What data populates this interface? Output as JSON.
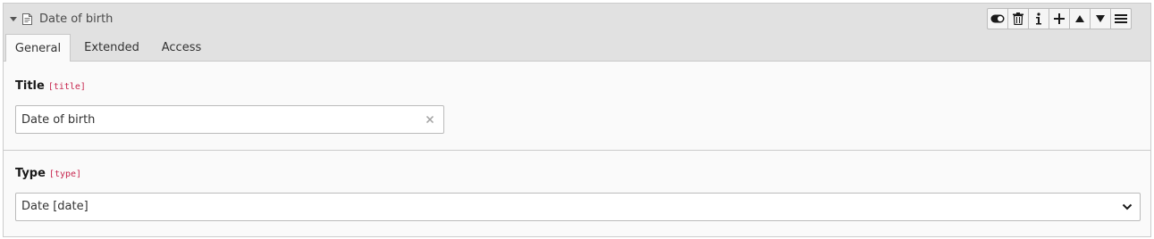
{
  "header": {
    "title": "Date of birth",
    "toolbar": [
      {
        "name": "toggle-visibility-button",
        "icon": "toggle-icon"
      },
      {
        "name": "delete-button",
        "icon": "trash-icon"
      },
      {
        "name": "info-button",
        "icon": "info-icon"
      },
      {
        "name": "add-button",
        "icon": "plus-icon"
      },
      {
        "name": "move-up-button",
        "icon": "arrow-up-icon"
      },
      {
        "name": "move-down-button",
        "icon": "arrow-down-icon"
      },
      {
        "name": "drag-handle-button",
        "icon": "menu-icon"
      }
    ]
  },
  "tabs": [
    {
      "label": "General",
      "active": true
    },
    {
      "label": "Extended",
      "active": false
    },
    {
      "label": "Access",
      "active": false
    }
  ],
  "fields": {
    "title": {
      "label": "Title",
      "code": "[title]",
      "value": "Date of birth"
    },
    "type": {
      "label": "Type",
      "code": "[type]",
      "selected": "Date [date]"
    }
  },
  "colors": {
    "header_bg": "#e1e1e1",
    "panel_bg": "#fafafa",
    "code_accent": "#c7254e",
    "border": "#cccccc"
  }
}
